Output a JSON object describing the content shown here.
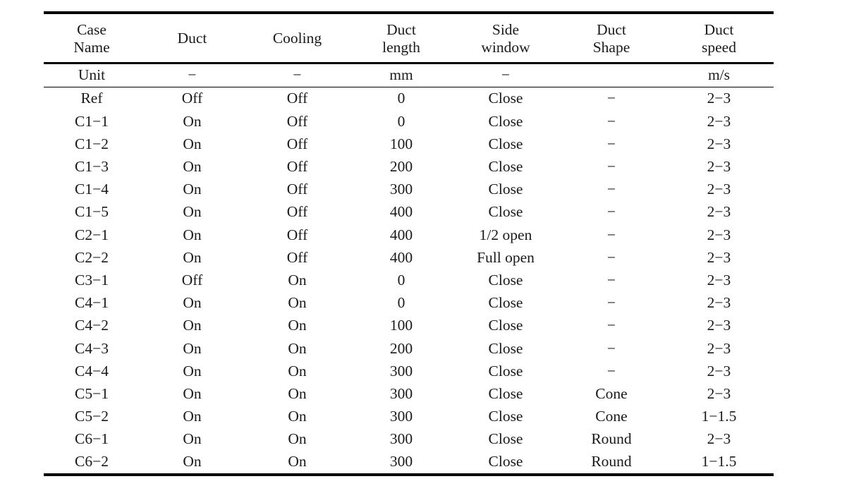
{
  "table": {
    "columns": [
      {
        "key": "case_name",
        "line1": "Case",
        "line2": "Name",
        "unit": "Unit"
      },
      {
        "key": "duct",
        "line1": "Duct",
        "line2": "",
        "unit": "−"
      },
      {
        "key": "cooling",
        "line1": "Cooling",
        "line2": "",
        "unit": "−"
      },
      {
        "key": "duct_length",
        "line1": "Duct",
        "line2": "length",
        "unit": "mm"
      },
      {
        "key": "side_window",
        "line1": "Side",
        "line2": "window",
        "unit": "−"
      },
      {
        "key": "duct_shape",
        "line1": "Duct",
        "line2": "Shape",
        "unit": ""
      },
      {
        "key": "duct_speed",
        "line1": "Duct",
        "line2": "speed",
        "unit": "m/s"
      }
    ],
    "rows": [
      {
        "case_name": "Ref",
        "duct": "Off",
        "cooling": "Off",
        "duct_length": "0",
        "side_window": "Close",
        "duct_shape": "−",
        "duct_speed": "2−3"
      },
      {
        "case_name": "C1−1",
        "duct": "On",
        "cooling": "Off",
        "duct_length": "0",
        "side_window": "Close",
        "duct_shape": "−",
        "duct_speed": "2−3"
      },
      {
        "case_name": "C1−2",
        "duct": "On",
        "cooling": "Off",
        "duct_length": "100",
        "side_window": "Close",
        "duct_shape": "−",
        "duct_speed": "2−3"
      },
      {
        "case_name": "C1−3",
        "duct": "On",
        "cooling": "Off",
        "duct_length": "200",
        "side_window": "Close",
        "duct_shape": "−",
        "duct_speed": "2−3"
      },
      {
        "case_name": "C1−4",
        "duct": "On",
        "cooling": "Off",
        "duct_length": "300",
        "side_window": "Close",
        "duct_shape": "−",
        "duct_speed": "2−3"
      },
      {
        "case_name": "C1−5",
        "duct": "On",
        "cooling": "Off",
        "duct_length": "400",
        "side_window": "Close",
        "duct_shape": "−",
        "duct_speed": "2−3"
      },
      {
        "case_name": "C2−1",
        "duct": "On",
        "cooling": "Off",
        "duct_length": "400",
        "side_window": "1/2 open",
        "duct_shape": "−",
        "duct_speed": "2−3"
      },
      {
        "case_name": "C2−2",
        "duct": "On",
        "cooling": "Off",
        "duct_length": "400",
        "side_window": "Full open",
        "duct_shape": "−",
        "duct_speed": "2−3"
      },
      {
        "case_name": "C3−1",
        "duct": "Off",
        "cooling": "On",
        "duct_length": "0",
        "side_window": "Close",
        "duct_shape": "−",
        "duct_speed": "2−3"
      },
      {
        "case_name": "C4−1",
        "duct": "On",
        "cooling": "On",
        "duct_length": "0",
        "side_window": "Close",
        "duct_shape": "−",
        "duct_speed": "2−3"
      },
      {
        "case_name": "C4−2",
        "duct": "On",
        "cooling": "On",
        "duct_length": "100",
        "side_window": "Close",
        "duct_shape": "−",
        "duct_speed": "2−3"
      },
      {
        "case_name": "C4−3",
        "duct": "On",
        "cooling": "On",
        "duct_length": "200",
        "side_window": "Close",
        "duct_shape": "−",
        "duct_speed": "2−3"
      },
      {
        "case_name": "C4−4",
        "duct": "On",
        "cooling": "On",
        "duct_length": "300",
        "side_window": "Close",
        "duct_shape": "−",
        "duct_speed": "2−3"
      },
      {
        "case_name": "C5−1",
        "duct": "On",
        "cooling": "On",
        "duct_length": "300",
        "side_window": "Close",
        "duct_shape": "Cone",
        "duct_speed": "2−3"
      },
      {
        "case_name": "C5−2",
        "duct": "On",
        "cooling": "On",
        "duct_length": "300",
        "side_window": "Close",
        "duct_shape": "Cone",
        "duct_speed": "1−1.5"
      },
      {
        "case_name": "C6−1",
        "duct": "On",
        "cooling": "On",
        "duct_length": "300",
        "side_window": "Close",
        "duct_shape": "Round",
        "duct_speed": "2−3"
      },
      {
        "case_name": "C6−2",
        "duct": "On",
        "cooling": "On",
        "duct_length": "300",
        "side_window": "Close",
        "duct_shape": "Round",
        "duct_speed": "1−1.5"
      }
    ]
  }
}
